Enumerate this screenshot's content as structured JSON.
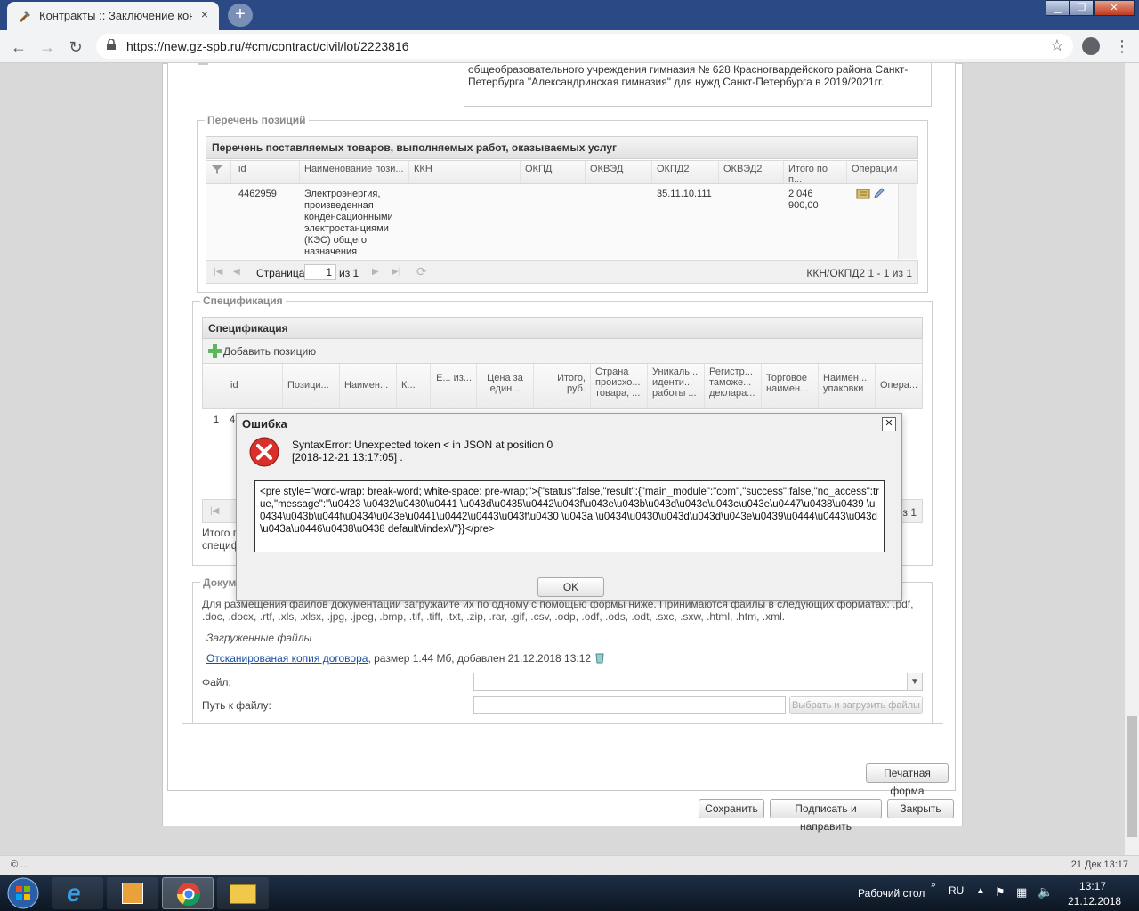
{
  "browser": {
    "tab_title": "Контракты :: Заключение контр",
    "tab_close": "×",
    "new_tab": "+",
    "url": "https://new.gz-spb.ru/#cm/contract/civil/lot/2223816",
    "window_min": "▁",
    "window_max": "❐",
    "window_close": "✕"
  },
  "address_text": "общеобразовательного учреждения гимназия № 628 Красногвардейского района Санкт-Петербурга \"Александринская гимназия\" для нужд Санкт-Петербурга в 2019/2021гг.",
  "positions": {
    "legend": "Перечень позиций",
    "grid_title": "Перечень поставляемых товаров, выполняемых работ, оказываемых услуг",
    "columns": [
      "id",
      "Наименование пози...",
      "ККН",
      "ОКПД",
      "ОКВЭД",
      "ОКПД2",
      "ОКВЭД2",
      "Итого по п...",
      "Операции"
    ],
    "rows": [
      {
        "id": "4462959",
        "name": "Электроэнергия, произведенная конденсационными электростанциями (КЭС) общего назначения",
        "okpd2": "35.11.10.111",
        "total": "2 046 900,00"
      }
    ],
    "pager": {
      "page_label": "Страница",
      "page_value": "1",
      "of_label": "из 1",
      "summary": "ККН/ОКПД2 1 - 1 из 1"
    }
  },
  "spec": {
    "legend": "Спецификация",
    "grid_title": "Спецификация",
    "add_label": "Добавить позицию",
    "columns": [
      "id",
      "Позици...",
      "Наимен...",
      "К...",
      "Е... из...",
      "Цена за един...",
      "Итого, руб.",
      "Страна происхо... товара, ...",
      "Уникаль... иденти... работы ...",
      "Регистр... таможе... деклара...",
      "Торговое наимен...",
      "Наимен... упаковки",
      "Опера..."
    ],
    "row_num": "1",
    "row_id": "4",
    "pager_summary": "з 1",
    "total_label": "Итого п",
    "spec_label": "специф"
  },
  "docs": {
    "legend": "Докум",
    "instructions": "Для размещения файлов документации загружайте их по одному с помощью формы ниже. Принимаются файлы в следующих форматах: .pdf, .doc, .docx, .rtf, .xls, .xlsx, .jpg, .jpeg, .bmp, .tif, .tiff, .txt, .zip, .rar, .gif, .csv, .odp, .odf, .ods, .odt, .sxc, .sxw, .html, .htm, .xml.",
    "uploaded_label": "Загруженные файлы",
    "file_link": "Отсканированая копия договора",
    "file_info": ", размер 1.44 Мб, добавлен 21.12.2018 13:12",
    "file_label": "Файл:",
    "path_label": "Путь к файлу:",
    "upload_button": "Выбрать и загрузить файлы"
  },
  "buttons": {
    "print": "Печатная форма",
    "save": "Сохранить",
    "sign": "Подписать и направить",
    "close": "Закрыть"
  },
  "modal": {
    "title": "Ошибка",
    "close": "✕",
    "error_line1": "SyntaxError: Unexpected token < in JSON at position 0",
    "error_line2": "[2018-12-21 13:17:05] .",
    "pre_content": "<pre style=\"word-wrap: break-word; white-space: pre-wrap;\">{\"status\":false,\"result\":{\"main_module\":\"com\",\"success\":false,\"no_access\":true,\"message\":\"\\u0423 \\u0432\\u0430\\u0441 \\u043d\\u0435\\u0442\\u043f\\u043e\\u043b\\u043d\\u043e\\u043c\\u043e\\u0447\\u0438\\u0439 \\u0434\\u043b\\u044f\\u0434\\u043e\\u0441\\u0442\\u0443\\u043f\\u0430 \\u043a \\u0434\\u0430\\u043d\\u043d\\u043e\\u0439\\u0444\\u0443\\u043d\\u043a\\u0446\\u0438\\u0438 default\\/index\\/\"}}</pre>",
    "ok": "OK"
  },
  "statusbar": {
    "left": "© ...",
    "right": "21 Дек 13:17"
  },
  "taskbar": {
    "desktop": "Рабочий стол",
    "lang": "RU",
    "time": "13:17",
    "date": "21.12.2018"
  }
}
